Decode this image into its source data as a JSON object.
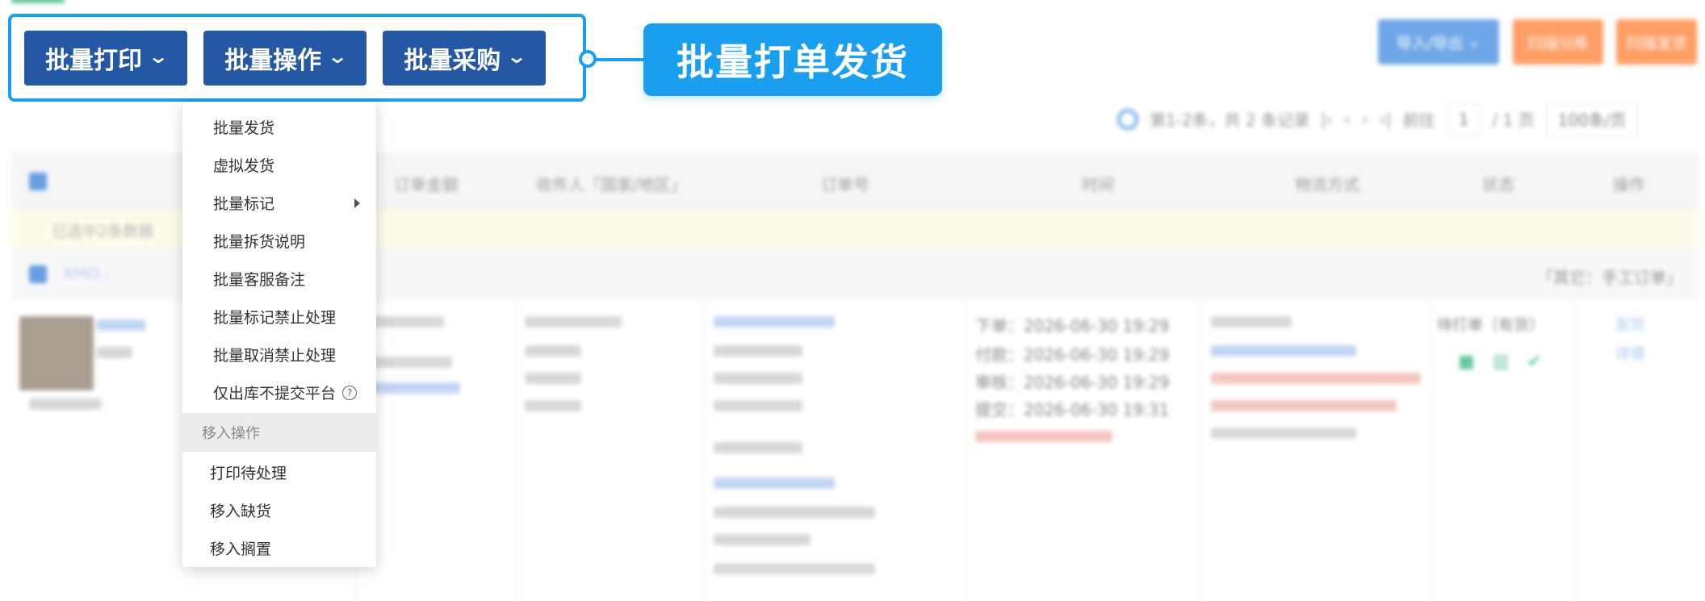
{
  "toolbar": {
    "batch_print": "批量打印",
    "batch_ops": "批量操作",
    "batch_purchase": "批量采购"
  },
  "callout": "批量打单发货",
  "menu": {
    "items": [
      "批量发货",
      "虚拟发货",
      "批量标记",
      "批量拆货说明",
      "批量客服备注",
      "批量标记禁止处理",
      "批量取消禁止处理",
      "仅出库不提交平台"
    ],
    "group_label": "移入操作",
    "move_items": [
      "打印待处理",
      "移入缺货",
      "移入搁置"
    ]
  },
  "top_right": {
    "import_export": "导入/导出",
    "scan_sort": "扫描分拣",
    "scan_ship": "扫描发货"
  },
  "pager": {
    "summary": "第1-2条，共 2 条记录",
    "goto": "前往",
    "page": "1",
    "total": "/ 1 页",
    "page_size": "100条/页"
  },
  "table": {
    "headers": [
      "订单金额",
      "收件人「国家/地区」",
      "订单号",
      "时间",
      "物流方式",
      "状态",
      "操作"
    ],
    "selected_notice": "已选中2条数据",
    "group_tag": "「其它：手工订单」",
    "times": [
      "下单：2026-06-30 19:29",
      "付款：2026-06-30 19:29",
      "审核：2026-06-30 19:29",
      "提交：2026-06-30 19:31"
    ],
    "status": "待打单（有货）",
    "ops": [
      "发货",
      "详情"
    ]
  },
  "colors": {
    "accent": "#1a9ff0",
    "toolbar_btn": "#2558a4",
    "import_btn": "#3a86e0",
    "scan_btn": "#ff7a2a"
  }
}
